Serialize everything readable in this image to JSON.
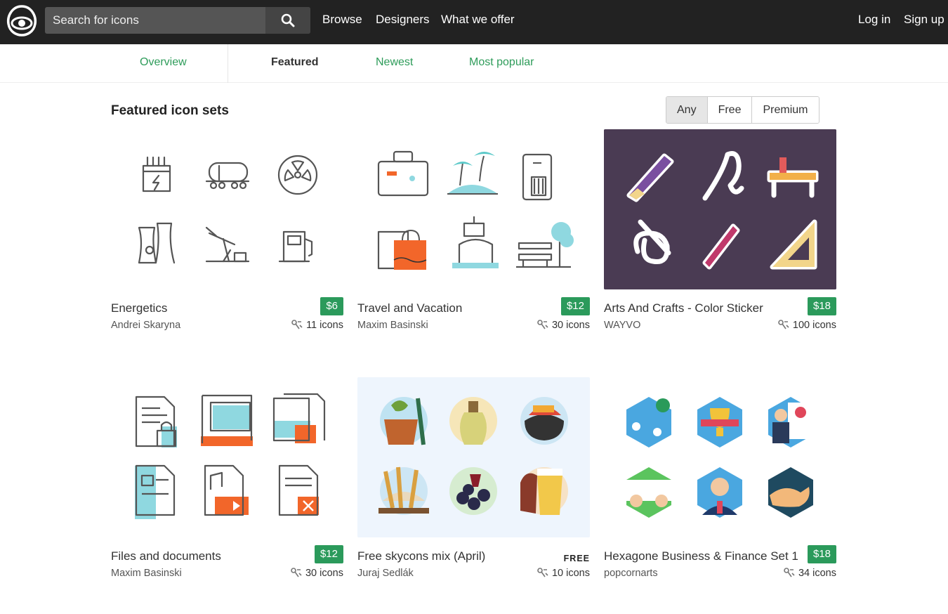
{
  "header": {
    "search_placeholder": "Search for icons",
    "nav": {
      "browse": "Browse",
      "designers": "Designers",
      "offer": "What we offer"
    },
    "auth": {
      "login": "Log in",
      "signup": "Sign up"
    }
  },
  "tabs": [
    "Overview",
    "Featured",
    "Newest",
    "Most popular"
  ],
  "section": {
    "title": "Featured icon sets"
  },
  "filter": [
    "Any",
    "Free",
    "Premium"
  ],
  "colors": {
    "accent": "#2b9a5b",
    "topbar": "#222222",
    "link": "#2e9c5a"
  },
  "cards": [
    {
      "title": "Energetics",
      "author": "Andrei Skaryna",
      "price": "$6",
      "count": "11 icons"
    },
    {
      "title": "Travel and Vacation",
      "author": "Maxim Basinski",
      "price": "$12",
      "count": "30 icons"
    },
    {
      "title": "Arts And Crafts - Color Sticker",
      "author": "WAYVO",
      "price": "$18",
      "count": "100 icons"
    },
    {
      "title": "Files and documents",
      "author": "Maxim Basinski",
      "price": "$12",
      "count": "30 icons"
    },
    {
      "title": "Free skycons mix (April)",
      "author": "Juraj Sedlák",
      "price": "FREE",
      "count": "10 icons"
    },
    {
      "title": "Hexagone Business & Finance Set 1",
      "author": "popcornarts",
      "price": "$18",
      "count": "34 icons"
    }
  ]
}
